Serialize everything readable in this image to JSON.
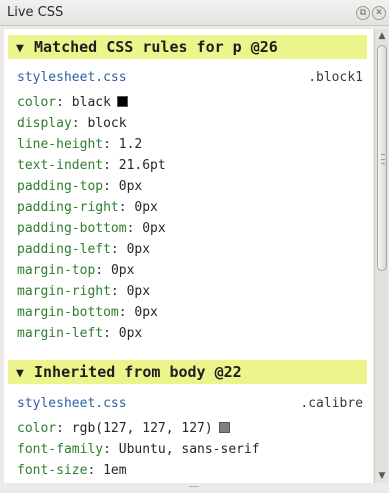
{
  "window": {
    "title": "Live CSS",
    "float_icon": "⧉",
    "close_icon": "✕"
  },
  "sections": [
    {
      "header": "Matched CSS rules for p @26",
      "toggle": "▼",
      "source": "stylesheet.css",
      "selector": ".block1",
      "properties": [
        {
          "name": "color",
          "value": "black",
          "swatch": "#000000"
        },
        {
          "name": "display",
          "value": "block"
        },
        {
          "name": "line-height",
          "value": "1.2"
        },
        {
          "name": "text-indent",
          "value": "21.6pt"
        },
        {
          "name": "padding-top",
          "value": "0px"
        },
        {
          "name": "padding-right",
          "value": "0px"
        },
        {
          "name": "padding-bottom",
          "value": "0px"
        },
        {
          "name": "padding-left",
          "value": "0px"
        },
        {
          "name": "margin-top",
          "value": "0px"
        },
        {
          "name": "margin-right",
          "value": "0px"
        },
        {
          "name": "margin-bottom",
          "value": "0px"
        },
        {
          "name": "margin-left",
          "value": "0px"
        }
      ]
    },
    {
      "header": "Inherited from body @22",
      "toggle": "▼",
      "source": "stylesheet.css",
      "selector": ".calibre",
      "properties": [
        {
          "name": "color",
          "value": "rgb(127, 127, 127)",
          "swatch": "#7f7f7f"
        },
        {
          "name": "font-family",
          "value": "Ubuntu, sans-serif"
        },
        {
          "name": "font-size",
          "value": "1em"
        }
      ]
    }
  ],
  "scrollbar": {
    "up_icon": "▲",
    "down_icon": "▼"
  }
}
